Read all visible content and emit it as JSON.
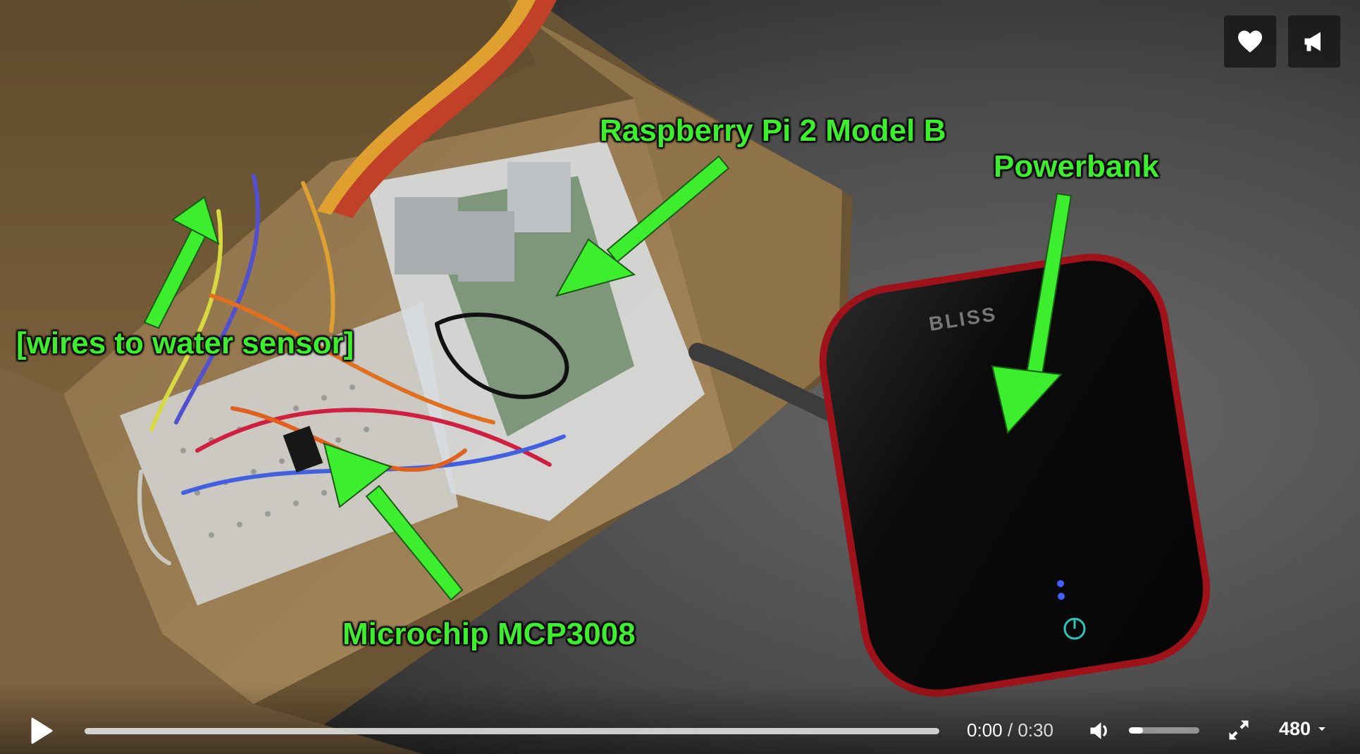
{
  "annotations": {
    "rpi": "Raspberry Pi 2 Model B",
    "powerbank": "Powerbank",
    "wires": "[wires to water sensor]",
    "mcp": "Microchip MCP3008"
  },
  "powerbank_brand": "BLISS",
  "top_buttons": {
    "like_icon": "heart-icon",
    "share_icon": "megaphone-icon"
  },
  "player": {
    "current_time": "0:00",
    "time_separator": "/",
    "duration": "0:30",
    "progress": 0,
    "volume": 0.2,
    "quality": "480",
    "play_icon": "play-icon",
    "volume_icon": "volume-icon",
    "fullscreen_icon": "fullscreen-icon",
    "quality_caret_icon": "caret-down-icon"
  },
  "colors": {
    "annotation_green": "#3dee2e",
    "player_bg": "#000000"
  }
}
